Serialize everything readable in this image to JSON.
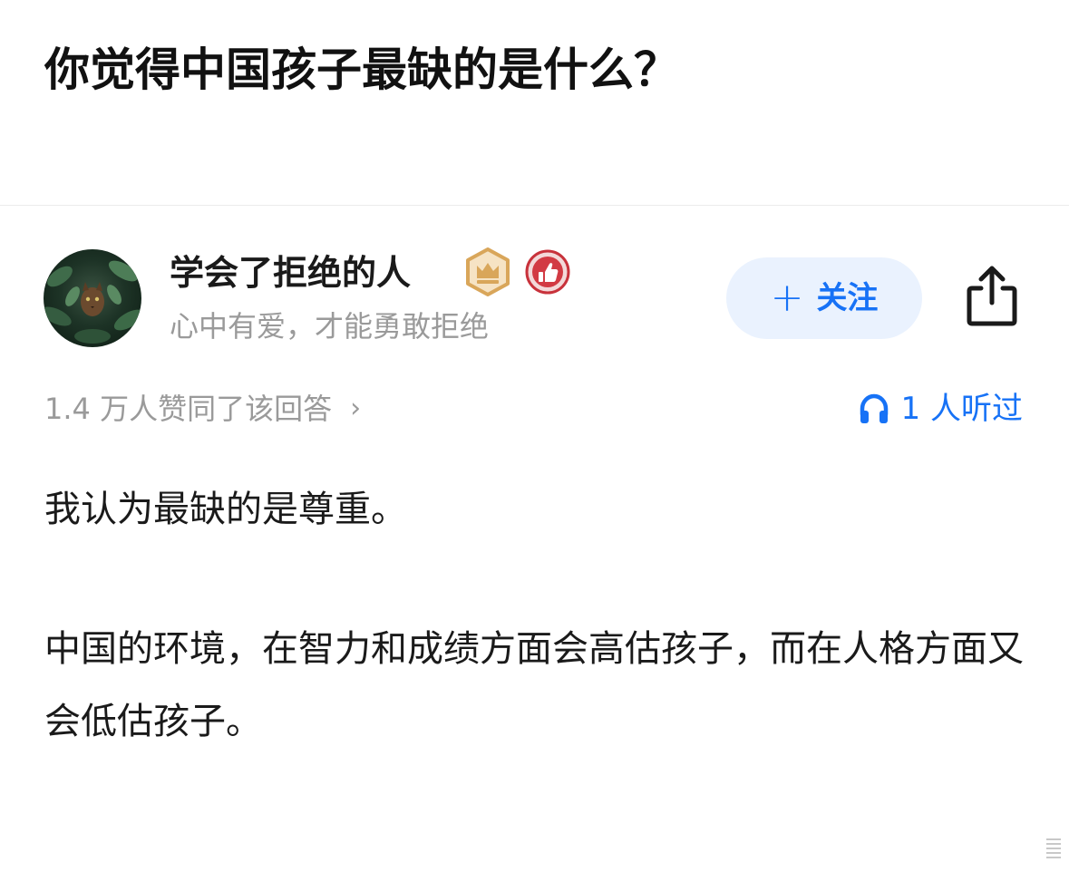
{
  "question": {
    "title": "你觉得中国孩子最缺的是什么？"
  },
  "author": {
    "name": "学会了拒绝的人",
    "bio": "心中有爱，才能勇敢拒绝",
    "badges": [
      "crown-badge-icon",
      "thumbs-up-badge-icon"
    ],
    "follow_label": "关注",
    "follow_plus": "+"
  },
  "stats": {
    "upvotes_text": "1.4 万人赞同了该回答",
    "upvotes_chevron": "›",
    "listened_text": "1 人听过"
  },
  "answer": {
    "paragraphs": [
      "我认为最缺的是尊重。",
      "中国的环境，在智力和成绩方面会高估孩子，而在人格方面又会低估孩子。"
    ]
  },
  "colors": {
    "accent": "#1772f6",
    "follow_bg": "#eaf2fe",
    "secondary_text": "#9a9a9a",
    "primary_text": "#1a1a1a"
  },
  "icons": {
    "share": "share-icon",
    "headphones": "headphones-icon",
    "chevron": "chevron-right-icon"
  }
}
